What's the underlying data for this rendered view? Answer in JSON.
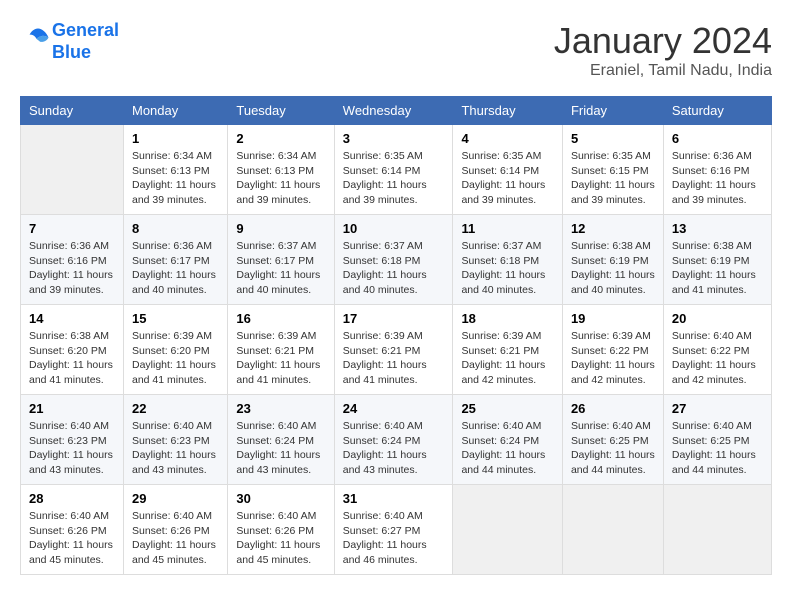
{
  "header": {
    "logo_line1": "General",
    "logo_line2": "Blue",
    "month": "January 2024",
    "location": "Eraniel, Tamil Nadu, India"
  },
  "weekdays": [
    "Sunday",
    "Monday",
    "Tuesday",
    "Wednesday",
    "Thursday",
    "Friday",
    "Saturday"
  ],
  "weeks": [
    [
      {
        "day": "",
        "empty": true
      },
      {
        "day": "1",
        "sunrise": "Sunrise: 6:34 AM",
        "sunset": "Sunset: 6:13 PM",
        "daylight": "Daylight: 11 hours and 39 minutes."
      },
      {
        "day": "2",
        "sunrise": "Sunrise: 6:34 AM",
        "sunset": "Sunset: 6:13 PM",
        "daylight": "Daylight: 11 hours and 39 minutes."
      },
      {
        "day": "3",
        "sunrise": "Sunrise: 6:35 AM",
        "sunset": "Sunset: 6:14 PM",
        "daylight": "Daylight: 11 hours and 39 minutes."
      },
      {
        "day": "4",
        "sunrise": "Sunrise: 6:35 AM",
        "sunset": "Sunset: 6:14 PM",
        "daylight": "Daylight: 11 hours and 39 minutes."
      },
      {
        "day": "5",
        "sunrise": "Sunrise: 6:35 AM",
        "sunset": "Sunset: 6:15 PM",
        "daylight": "Daylight: 11 hours and 39 minutes."
      },
      {
        "day": "6",
        "sunrise": "Sunrise: 6:36 AM",
        "sunset": "Sunset: 6:16 PM",
        "daylight": "Daylight: 11 hours and 39 minutes."
      }
    ],
    [
      {
        "day": "7",
        "sunrise": "Sunrise: 6:36 AM",
        "sunset": "Sunset: 6:16 PM",
        "daylight": "Daylight: 11 hours and 39 minutes."
      },
      {
        "day": "8",
        "sunrise": "Sunrise: 6:36 AM",
        "sunset": "Sunset: 6:17 PM",
        "daylight": "Daylight: 11 hours and 40 minutes."
      },
      {
        "day": "9",
        "sunrise": "Sunrise: 6:37 AM",
        "sunset": "Sunset: 6:17 PM",
        "daylight": "Daylight: 11 hours and 40 minutes."
      },
      {
        "day": "10",
        "sunrise": "Sunrise: 6:37 AM",
        "sunset": "Sunset: 6:18 PM",
        "daylight": "Daylight: 11 hours and 40 minutes."
      },
      {
        "day": "11",
        "sunrise": "Sunrise: 6:37 AM",
        "sunset": "Sunset: 6:18 PM",
        "daylight": "Daylight: 11 hours and 40 minutes."
      },
      {
        "day": "12",
        "sunrise": "Sunrise: 6:38 AM",
        "sunset": "Sunset: 6:19 PM",
        "daylight": "Daylight: 11 hours and 40 minutes."
      },
      {
        "day": "13",
        "sunrise": "Sunrise: 6:38 AM",
        "sunset": "Sunset: 6:19 PM",
        "daylight": "Daylight: 11 hours and 41 minutes."
      }
    ],
    [
      {
        "day": "14",
        "sunrise": "Sunrise: 6:38 AM",
        "sunset": "Sunset: 6:20 PM",
        "daylight": "Daylight: 11 hours and 41 minutes."
      },
      {
        "day": "15",
        "sunrise": "Sunrise: 6:39 AM",
        "sunset": "Sunset: 6:20 PM",
        "daylight": "Daylight: 11 hours and 41 minutes."
      },
      {
        "day": "16",
        "sunrise": "Sunrise: 6:39 AM",
        "sunset": "Sunset: 6:21 PM",
        "daylight": "Daylight: 11 hours and 41 minutes."
      },
      {
        "day": "17",
        "sunrise": "Sunrise: 6:39 AM",
        "sunset": "Sunset: 6:21 PM",
        "daylight": "Daylight: 11 hours and 41 minutes."
      },
      {
        "day": "18",
        "sunrise": "Sunrise: 6:39 AM",
        "sunset": "Sunset: 6:21 PM",
        "daylight": "Daylight: 11 hours and 42 minutes."
      },
      {
        "day": "19",
        "sunrise": "Sunrise: 6:39 AM",
        "sunset": "Sunset: 6:22 PM",
        "daylight": "Daylight: 11 hours and 42 minutes."
      },
      {
        "day": "20",
        "sunrise": "Sunrise: 6:40 AM",
        "sunset": "Sunset: 6:22 PM",
        "daylight": "Daylight: 11 hours and 42 minutes."
      }
    ],
    [
      {
        "day": "21",
        "sunrise": "Sunrise: 6:40 AM",
        "sunset": "Sunset: 6:23 PM",
        "daylight": "Daylight: 11 hours and 43 minutes."
      },
      {
        "day": "22",
        "sunrise": "Sunrise: 6:40 AM",
        "sunset": "Sunset: 6:23 PM",
        "daylight": "Daylight: 11 hours and 43 minutes."
      },
      {
        "day": "23",
        "sunrise": "Sunrise: 6:40 AM",
        "sunset": "Sunset: 6:24 PM",
        "daylight": "Daylight: 11 hours and 43 minutes."
      },
      {
        "day": "24",
        "sunrise": "Sunrise: 6:40 AM",
        "sunset": "Sunset: 6:24 PM",
        "daylight": "Daylight: 11 hours and 43 minutes."
      },
      {
        "day": "25",
        "sunrise": "Sunrise: 6:40 AM",
        "sunset": "Sunset: 6:24 PM",
        "daylight": "Daylight: 11 hours and 44 minutes."
      },
      {
        "day": "26",
        "sunrise": "Sunrise: 6:40 AM",
        "sunset": "Sunset: 6:25 PM",
        "daylight": "Daylight: 11 hours and 44 minutes."
      },
      {
        "day": "27",
        "sunrise": "Sunrise: 6:40 AM",
        "sunset": "Sunset: 6:25 PM",
        "daylight": "Daylight: 11 hours and 44 minutes."
      }
    ],
    [
      {
        "day": "28",
        "sunrise": "Sunrise: 6:40 AM",
        "sunset": "Sunset: 6:26 PM",
        "daylight": "Daylight: 11 hours and 45 minutes."
      },
      {
        "day": "29",
        "sunrise": "Sunrise: 6:40 AM",
        "sunset": "Sunset: 6:26 PM",
        "daylight": "Daylight: 11 hours and 45 minutes."
      },
      {
        "day": "30",
        "sunrise": "Sunrise: 6:40 AM",
        "sunset": "Sunset: 6:26 PM",
        "daylight": "Daylight: 11 hours and 45 minutes."
      },
      {
        "day": "31",
        "sunrise": "Sunrise: 6:40 AM",
        "sunset": "Sunset: 6:27 PM",
        "daylight": "Daylight: 11 hours and 46 minutes."
      },
      {
        "day": "",
        "empty": true
      },
      {
        "day": "",
        "empty": true
      },
      {
        "day": "",
        "empty": true
      }
    ]
  ]
}
